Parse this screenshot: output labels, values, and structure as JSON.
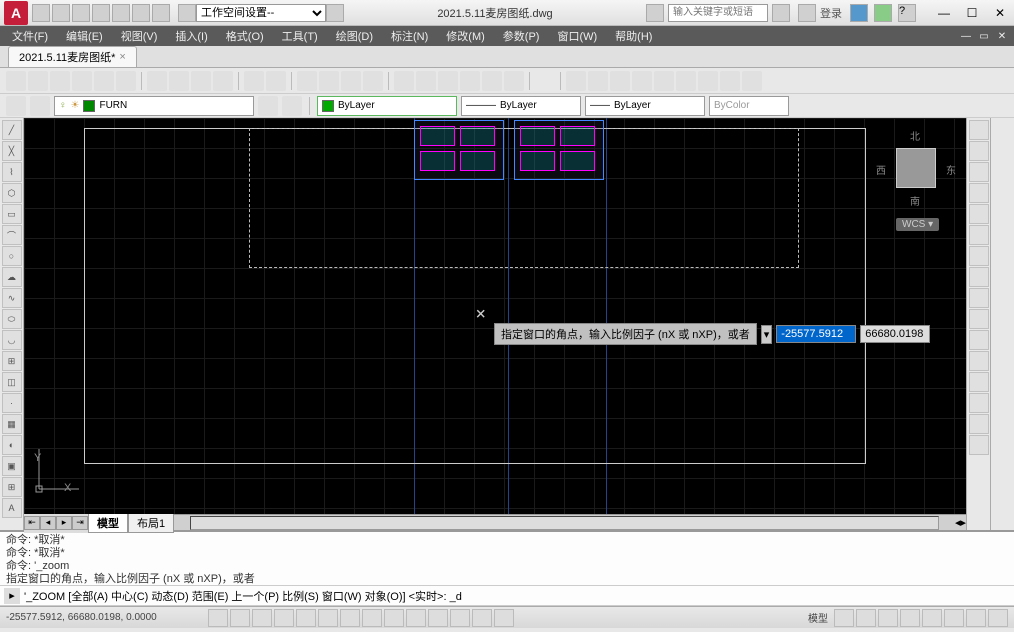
{
  "title": "2021.5.11麦房图纸.dwg",
  "workspace_label": "工作空间设置--",
  "search_placeholder": "输入关键字或短语",
  "login_label": "登录",
  "menu": [
    "文件(F)",
    "编辑(E)",
    "视图(V)",
    "插入(I)",
    "格式(O)",
    "工具(T)",
    "绘图(D)",
    "标注(N)",
    "修改(M)",
    "参数(P)",
    "窗口(W)",
    "帮助(H)"
  ],
  "file_tab": "2021.5.11麦房图纸*",
  "layer": {
    "name": "FURN",
    "bylayer1": "ByLayer",
    "bylayer2": "ByLayer",
    "bylayer3": "ByLayer",
    "bycolor": "ByColor"
  },
  "viewcube": {
    "n": "北",
    "s": "南",
    "e": "东",
    "w": "西",
    "wcs": "WCS ▾"
  },
  "ucs": {
    "x": "X",
    "y": "Y"
  },
  "dynamic_input": {
    "prompt": "指定窗口的角点，输入比例因子 (nX 或 nXP)，或者",
    "val1": "-25577.5912",
    "val2": "66680.0198"
  },
  "model_tabs": {
    "model": "模型",
    "layout": "布局1"
  },
  "cmd_history": [
    "命令: *取消*",
    "命令: *取消*",
    "命令: '_zoom",
    "指定窗口的角点，输入比例因子 (nX 或 nXP)，或者"
  ],
  "cmd_line": "'_ZOOM [全部(A) 中心(C) 动态(D) 范围(E) 上一个(P) 比例(S) 窗口(W) 对象(O)] <实时>: _d",
  "status": {
    "coords": "-25577.5912, 66680.0198, 0.0000",
    "right": "模型"
  },
  "file_tab_close": "×"
}
